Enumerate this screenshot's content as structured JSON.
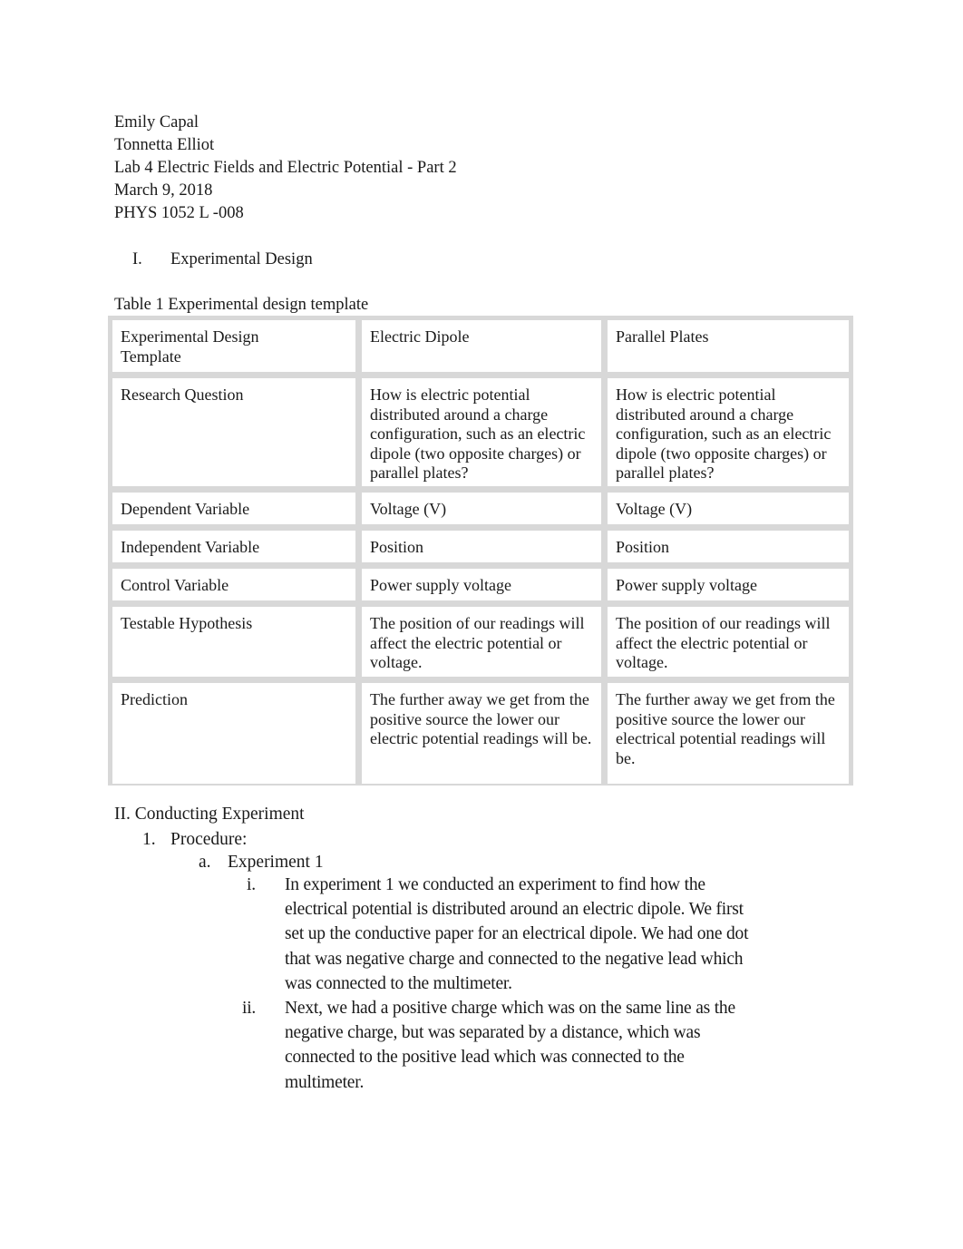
{
  "header": {
    "lines": [
      "Emily Capal",
      "Tonnetta Elliot",
      "Lab 4 Electric Fields and Electric Potential - Part 2",
      "March 9, 2018",
      "PHYS 1052 L -008"
    ]
  },
  "section1": {
    "numeral": "I.",
    "title": "Experimental Design"
  },
  "table": {
    "caption": "Table 1 Experimental design template",
    "rows": [
      [
        "Experimental Design Template",
        "Electric Dipole",
        "Parallel Plates"
      ],
      [
        "Research Question",
        "How is electric potential distributed around a charge configuration, such as an electric dipole (two opposite charges) or parallel plates?",
        "How is electric potential distributed around a charge configuration, such as an electric dipole (two opposite charges) or parallel plates?"
      ],
      [
        "Dependent Variable",
        "Voltage (V)",
        "Voltage (V)"
      ],
      [
        "Independent Variable",
        "Position",
        "Position"
      ],
      [
        "Control Variable",
        "Power supply voltage",
        "Power supply voltage"
      ],
      [
        "Testable Hypothesis",
        "The position of our readings will affect the electric potential or voltage.",
        "The position of our readings will affect the electric potential or voltage."
      ],
      [
        "Prediction",
        "The further away we get from the positive source the lower our electric potential readings will be.",
        "The further away we get from the positive source the lower our electrical potential readings will be."
      ]
    ]
  },
  "section2": {
    "title": "II. Conducting Experiment",
    "item1_marker": "1.",
    "item1_label": "Procedure:",
    "suba_marker": "a.",
    "suba_label": "Experiment 1",
    "steps": [
      {
        "marker": "i.",
        "lines": [
          "In experiment 1 we conducted an experiment to find how the",
          "electrical potential is distributed around an electric dipole. We first",
          "set up the conductive paper for an electrical dipole. We had one dot",
          "that was negative charge and connected to the negative lead which",
          "was connected to the multimeter."
        ]
      },
      {
        "marker": "ii.",
        "lines": [
          "Next, we had a positive charge which was on the same line as the",
          "negative charge, but was separated by a distance, which was",
          "connected to the positive lead which was connected to the",
          "multimeter."
        ]
      }
    ]
  }
}
